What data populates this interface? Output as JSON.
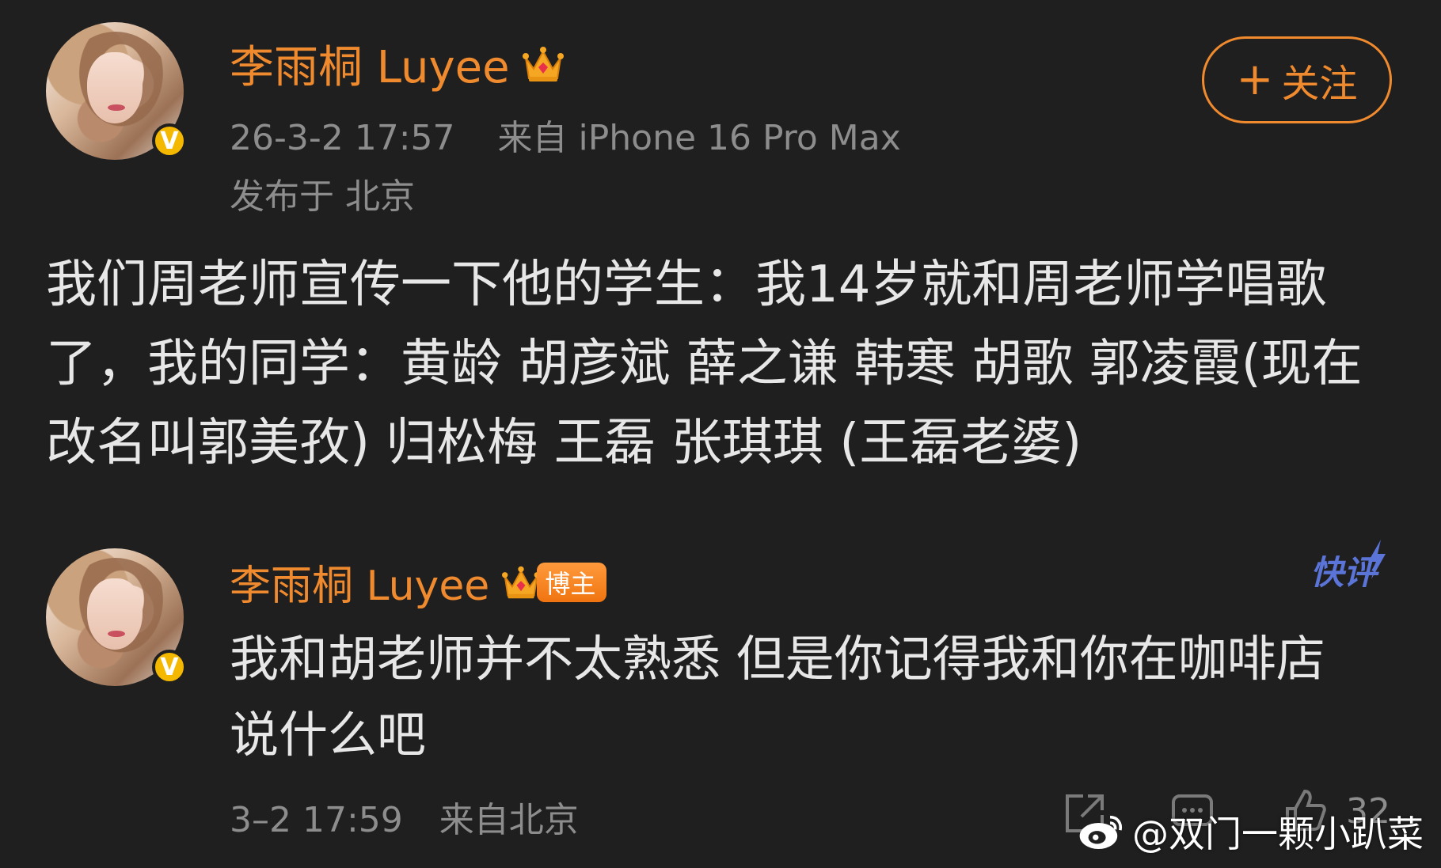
{
  "post": {
    "author_name": "李雨桐 Luyee",
    "timestamp": "26-3-2 17:57",
    "source": "来自 iPhone 16 Pro Max",
    "location": "发布于 北京",
    "follow_label": "关注",
    "body": "我们周老师宣传一下他的学生：我14岁就和周老师学唱歌了，我的同学：黄龄 胡彦斌 薛之谦 韩寒 胡歌 郭凌霞(现在改名叫郭美孜) 归松梅 王磊 张琪琪 (王磊老婆)",
    "verified_badge": "V"
  },
  "comment": {
    "author_name": "李雨桐 Luyee",
    "badge": "博主",
    "tag": "快评",
    "text": "我和胡老师并不太熟悉  但是你记得我和你在咖啡店说什么吧",
    "time": "3–2 17:59",
    "location": "来自北京",
    "like_count": "32",
    "verified_badge": "V"
  },
  "watermark": {
    "text": "@双门一颗小趴菜"
  },
  "colors": {
    "background": "#1f1f1f",
    "accent_orange": "#f08a2e",
    "meta_gray": "#8d8d8d",
    "badge_yellow": "#f5b800",
    "kuaiping_blue": "#5b74d8"
  },
  "icons": [
    "crown-icon",
    "verified-icon",
    "share-icon",
    "comment-icon",
    "like-icon",
    "weibo-logo-icon"
  ]
}
